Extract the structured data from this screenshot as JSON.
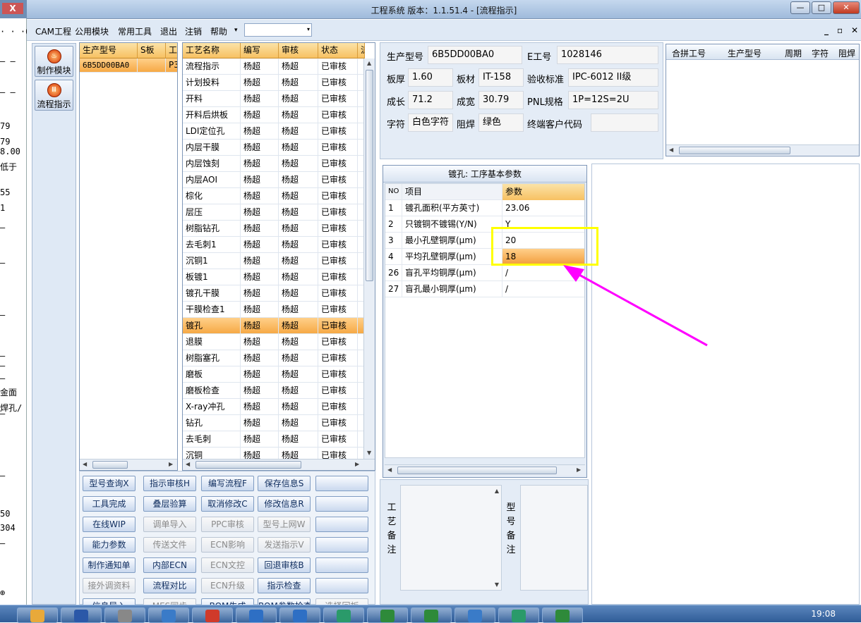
{
  "window": {
    "title": "工程系统   版本：1.1.51.4 - [流程指示]",
    "min": "—",
    "max": "□",
    "close": "✕"
  },
  "bgwin": {
    "close": "X",
    "lines": [
      "· · ·6",
      "— —",
      "— —",
      "79",
      "79",
      "8.00",
      "低于",
      "55",
      "1",
      "—",
      "—",
      "—",
      "—",
      "—",
      "—",
      "金面",
      "焊孔/",
      "—",
      "—",
      "50",
      "304",
      "—",
      "⊕"
    ]
  },
  "menu": {
    "items": [
      "CAM工程",
      "公用模块",
      "常用工具",
      "退出",
      "注销",
      "帮助"
    ],
    "dropdown_arrow": "▾",
    "combo_value": "",
    "mdi": [
      "_",
      "▫",
      "✕"
    ]
  },
  "leftnav": {
    "items": [
      {
        "label": "制作模块",
        "icon": "flame-icon"
      },
      {
        "label": "流程指示",
        "icon": "process-icon"
      }
    ]
  },
  "model_grid": {
    "headers": [
      "生产型号",
      "S板",
      "工"
    ],
    "rows": [
      [
        "6B5DD00BA0",
        "",
        "P3"
      ]
    ]
  },
  "process_grid": {
    "headers": [
      "工艺名称",
      "编写",
      "审核",
      "状态",
      "流"
    ],
    "rows": [
      [
        "流程指示",
        "杨超",
        "杨超",
        "已审核"
      ],
      [
        "计划投料",
        "杨超",
        "杨超",
        "已审核"
      ],
      [
        "开料",
        "杨超",
        "杨超",
        "已审核"
      ],
      [
        "开料后烘板",
        "杨超",
        "杨超",
        "已审核"
      ],
      [
        "LDI定位孔",
        "杨超",
        "杨超",
        "已审核"
      ],
      [
        "内层干膜",
        "杨超",
        "杨超",
        "已审核"
      ],
      [
        "内层蚀刻",
        "杨超",
        "杨超",
        "已审核"
      ],
      [
        "内层AOI",
        "杨超",
        "杨超",
        "已审核"
      ],
      [
        "棕化",
        "杨超",
        "杨超",
        "已审核"
      ],
      [
        "层压",
        "杨超",
        "杨超",
        "已审核"
      ],
      [
        "树脂钻孔",
        "杨超",
        "杨超",
        "已审核"
      ],
      [
        "去毛刺1",
        "杨超",
        "杨超",
        "已审核"
      ],
      [
        "沉铜1",
        "杨超",
        "杨超",
        "已审核"
      ],
      [
        "板镀1",
        "杨超",
        "杨超",
        "已审核"
      ],
      [
        "镀孔干膜",
        "杨超",
        "杨超",
        "已审核"
      ],
      [
        "干膜检查1",
        "杨超",
        "杨超",
        "已审核"
      ],
      [
        "镀孔",
        "杨超",
        "杨超",
        "已审核"
      ],
      [
        "退膜",
        "杨超",
        "杨超",
        "已审核"
      ],
      [
        "树脂塞孔",
        "杨超",
        "杨超",
        "已审核"
      ],
      [
        "磨板",
        "杨超",
        "杨超",
        "已审核"
      ],
      [
        "磨板检查",
        "杨超",
        "杨超",
        "已审核"
      ],
      [
        "X-ray冲孔",
        "杨超",
        "杨超",
        "已审核"
      ],
      [
        "钻孔",
        "杨超",
        "杨超",
        "已审核"
      ],
      [
        "去毛刺",
        "杨超",
        "杨超",
        "已审核"
      ],
      [
        "沉铜",
        "杨超",
        "杨超",
        "已审核"
      ]
    ],
    "selected": 16
  },
  "buttons": [
    [
      {
        "l": "型号查询X",
        "d": false
      },
      {
        "l": "指示审核H",
        "d": false
      },
      {
        "l": "编写流程F",
        "d": false
      },
      {
        "l": "保存信息S",
        "d": false
      },
      {
        "l": "",
        "d": false
      }
    ],
    [
      {
        "l": "工具完成",
        "d": false
      },
      {
        "l": "叠层验算",
        "d": false
      },
      {
        "l": "取消修改C",
        "d": false
      },
      {
        "l": "修改信息R",
        "d": false
      },
      {
        "l": "",
        "d": false
      }
    ],
    [
      {
        "l": "在线WIP",
        "d": false
      },
      {
        "l": "调单导入",
        "d": true
      },
      {
        "l": "PPC审核",
        "d": true
      },
      {
        "l": "型号上网W",
        "d": true
      },
      {
        "l": "",
        "d": false
      }
    ],
    [
      {
        "l": "能力参数",
        "d": false
      },
      {
        "l": "传送文件",
        "d": true
      },
      {
        "l": "ECN影响",
        "d": true
      },
      {
        "l": "发送指示V",
        "d": true
      },
      {
        "l": "",
        "d": false
      }
    ],
    [
      {
        "l": "制作通知单",
        "d": false
      },
      {
        "l": "内部ECN",
        "d": false
      },
      {
        "l": "ECN文控",
        "d": true
      },
      {
        "l": "回退审核B",
        "d": false
      },
      {
        "l": "",
        "d": false
      }
    ],
    [
      {
        "l": "接外调资料",
        "d": true
      },
      {
        "l": "流程对比",
        "d": false
      },
      {
        "l": "ECN升级",
        "d": true
      },
      {
        "l": "指示检查",
        "d": false
      },
      {
        "l": "",
        "d": false
      }
    ],
    [
      {
        "l": "信息导入",
        "d": false
      },
      {
        "l": "MES同步",
        "d": true
      },
      {
        "l": "BOM生成",
        "d": false
      },
      {
        "l": "BOM参数检查",
        "d": false
      },
      {
        "l": "选择回板",
        "d": true
      }
    ]
  ],
  "info": {
    "prod_model_label": "生产型号",
    "prod_model": "6B5DD00BA0",
    "e_no_label": "E工号",
    "e_no": "1028146",
    "thickness_label": "板厚",
    "thickness": "1.60",
    "material_label": "板材",
    "material": "IT-158",
    "std_label": "验收标准",
    "std": "IPC-6012 II级",
    "length_label": "成长",
    "length": "71.2",
    "width_label": "成宽",
    "width": "30.79",
    "pnl_label": "PNL规格",
    "pnl": "1P=12S=2U",
    "char_label": "字符",
    "char": "白色字符",
    "mask_label": "阻焊",
    "mask": "绿色",
    "cust_label": "终端客户代码",
    "cust": ""
  },
  "merge": {
    "headers": [
      "合拼工号",
      "生产型号",
      "周期",
      "字符",
      "阻焊"
    ]
  },
  "params": {
    "title": "镀孔: 工序基本参数",
    "headers": [
      "NO",
      "项目",
      "参数"
    ],
    "rows": [
      [
        "1",
        "镀孔面积(平方英寸)",
        "23.06"
      ],
      [
        "2",
        "只镀铜不镀锡(Y/N)",
        "Y"
      ],
      [
        "3",
        "最小孔壁铜厚(μm)",
        "20"
      ],
      [
        "4",
        "平均孔壁铜厚(μm)",
        "18"
      ],
      [
        "26",
        "盲孔平均铜厚(μm)",
        "/"
      ],
      [
        "27",
        "盲孔最小铜厚(μm)",
        "/"
      ]
    ],
    "selected": 3
  },
  "notes": {
    "process_label": "工艺备注",
    "model_label": "型号备注"
  },
  "taskbar": {
    "clock": "19:08",
    "colors": [
      "#e8a93a",
      "#2b58a8",
      "#888",
      "#3a7bc8",
      "#d03a2a",
      "#2e6fc4",
      "#2e6fc4",
      "#2a9a6a",
      "#2e8a3a",
      "#2e8a3a",
      "#3a7bc8",
      "#2a9a6a",
      "#2e8a3a"
    ]
  }
}
